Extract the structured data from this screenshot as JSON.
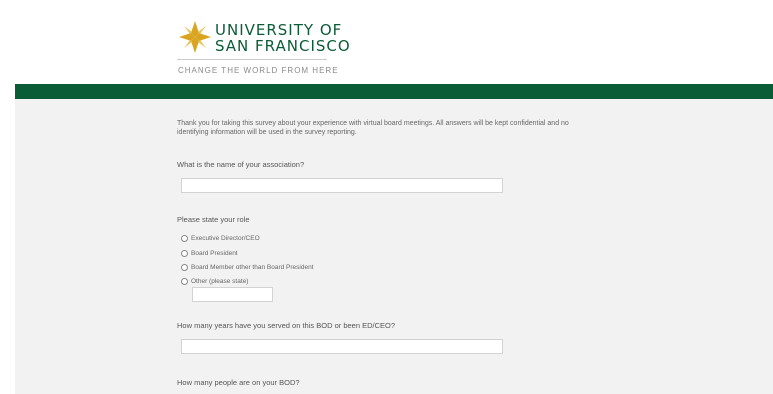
{
  "header": {
    "logo_line1": "UNIVERSITY OF",
    "logo_line2": "SAN FRANCISCO",
    "tagline": "CHANGE THE WORLD FROM HERE",
    "logo_icon": "usf-cross-logo-icon"
  },
  "colors": {
    "brand_green": "#0a5c36",
    "brand_gold": "#d9a520",
    "panel_bg": "#f2f2f2"
  },
  "survey": {
    "intro": "Thank you for taking this survey about your experience with virtual board meetings. All answers will be kept confidential and no identifying information will be used in the survey reporting.",
    "q1": {
      "label": "What is the name of your association?",
      "value": ""
    },
    "q2": {
      "label": "Please state your role",
      "options": [
        "Executive Director/CEO",
        "Board President",
        "Board Member other than Board President",
        "Other (please state)"
      ],
      "other_value": ""
    },
    "q3": {
      "label": "How many years have you served on this BOD or been ED/CEO?",
      "value": ""
    },
    "q4": {
      "label": "How many people are on your BOD?"
    }
  }
}
